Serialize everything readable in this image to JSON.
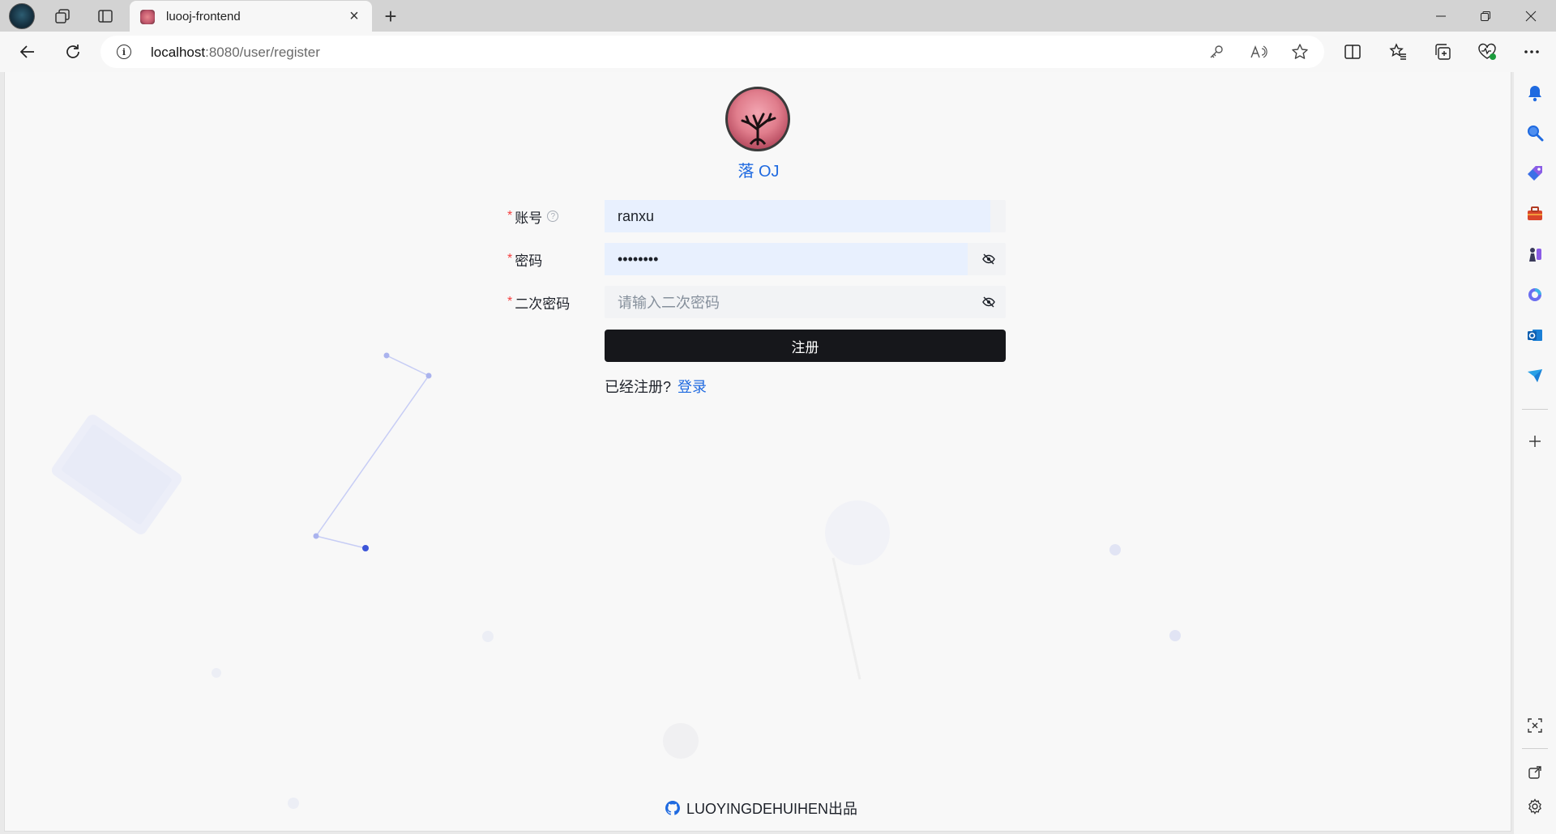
{
  "browser": {
    "tab": {
      "title": "luooj-frontend"
    },
    "address": {
      "host": "localhost",
      "path": ":8080/user/register"
    }
  },
  "page": {
    "brand": "落 OJ",
    "form": {
      "account": {
        "label": "账号",
        "value": "ranxu"
      },
      "password": {
        "label": "密码",
        "value": "••••••••"
      },
      "confirm": {
        "label": "二次密码",
        "placeholder": "请输入二次密码"
      },
      "submit_label": "注册",
      "already_text": "已经注册?",
      "login_link": "登录"
    },
    "footer": "LUOYINGDEHUIHEN出品"
  },
  "colors": {
    "accent": "#1f6ae0",
    "button": "#16171b",
    "required": "#f53f3f",
    "autofill": "#e8f0fe"
  }
}
